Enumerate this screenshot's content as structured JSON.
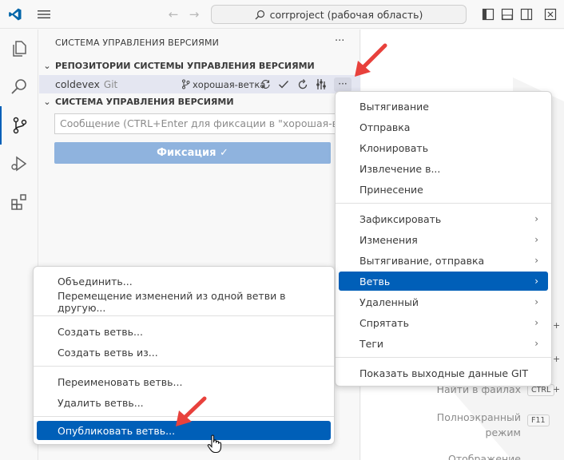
{
  "titlebar": {
    "search_text": "corrproject (рабочая область)"
  },
  "sidebar": {
    "title": "СИСТЕМА УПРАВЛЕНИЯ ВЕРСИЯМИ",
    "more": "···",
    "repos_header": "РЕПОЗИТОРИИ СИСТЕМЫ УПРАВЛЕНИЯ ВЕРСИЯМИ",
    "repo": {
      "name": "coldevex",
      "type": "Git",
      "branch": "хорошая-ветка",
      "more": "···"
    },
    "scm_header": "СИСТЕМА УПРАВЛЕНИЯ ВЕРСИЯМИ",
    "message_placeholder": "Сообщение (CTRL+Enter для фиксации в \"хорошая-ветка\")",
    "commit_label": "Фиксация ✓"
  },
  "main_menu": {
    "items": [
      {
        "label": "Вытягивание"
      },
      {
        "label": "Отправка"
      },
      {
        "label": "Клонировать"
      },
      {
        "label": "Извлечение в..."
      },
      {
        "label": "Принесение"
      },
      {
        "label": "Зафиксировать",
        "arrow": "›"
      },
      {
        "label": "Изменения",
        "arrow": "›"
      },
      {
        "label": "Вытягивание, отправка",
        "arrow": "›"
      },
      {
        "label": "Ветвь",
        "arrow": "›"
      },
      {
        "label": "Удаленный",
        "arrow": "›"
      },
      {
        "label": "Спрятать",
        "arrow": "›"
      },
      {
        "label": "Теги",
        "arrow": "›"
      },
      {
        "label": "Показать выходные данные GIT"
      }
    ]
  },
  "branch_menu": {
    "items": [
      {
        "label": "Объединить..."
      },
      {
        "label": "Перемещение изменений из одной ветви в другую..."
      },
      {
        "label": "Создать ветвь..."
      },
      {
        "label": "Создать ветвь из..."
      },
      {
        "label": "Переименовать ветвь..."
      },
      {
        "label": "Удалить ветвь..."
      },
      {
        "label": "Опубликовать ветвь..."
      }
    ]
  },
  "editor_hints": {
    "find_label": "Найти в файлах",
    "find_key": "CTRL",
    "full_label_1": "Полноэкранный",
    "full_label_2": "режим",
    "full_key": "F11",
    "cut_label": "Отображение",
    "plus": "+"
  },
  "colors": {
    "accent": "#005fb8",
    "arrow": "#e8413c"
  }
}
